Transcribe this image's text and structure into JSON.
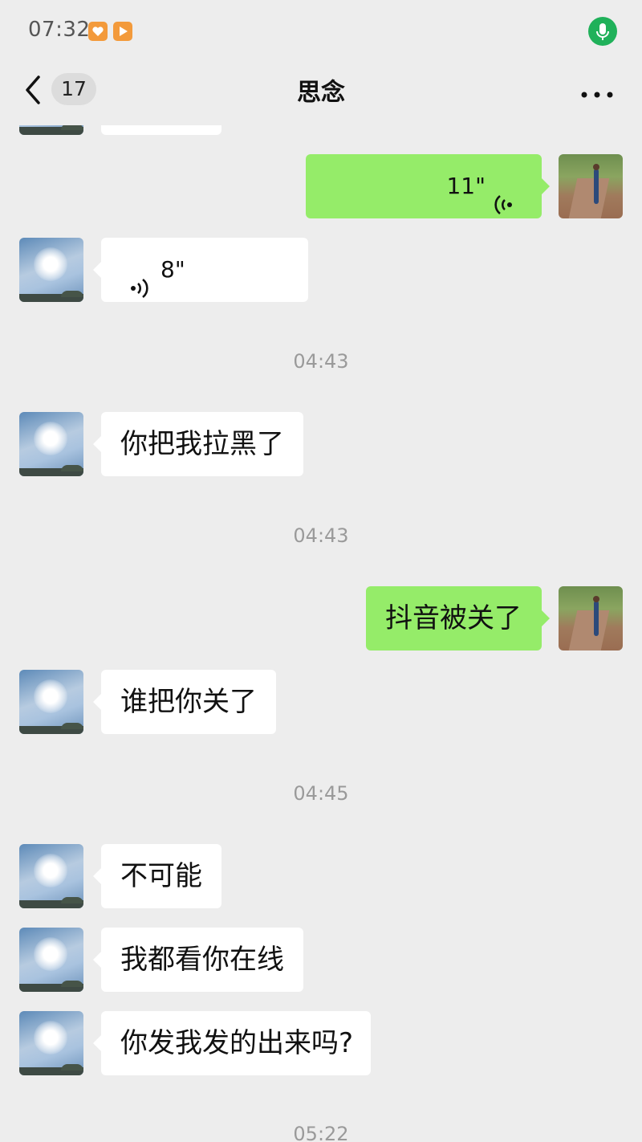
{
  "status_bar": {
    "time": "07:32"
  },
  "header": {
    "back_count": "17",
    "title": "思念"
  },
  "messages": [
    {
      "type": "voice",
      "side": "out",
      "duration": "11\""
    },
    {
      "type": "voice",
      "side": "in",
      "duration": "8\""
    },
    {
      "type": "time",
      "text": "04:43"
    },
    {
      "type": "text",
      "side": "in",
      "text": "你把我拉黑了"
    },
    {
      "type": "time",
      "text": "04:43"
    },
    {
      "type": "text",
      "side": "out",
      "text": "抖音被关了"
    },
    {
      "type": "text",
      "side": "in",
      "text": "谁把你关了"
    },
    {
      "type": "time",
      "text": "04:45"
    },
    {
      "type": "text",
      "side": "in",
      "text": "不可能"
    },
    {
      "type": "text",
      "side": "in",
      "text": "我都看你在线"
    },
    {
      "type": "text",
      "side": "in",
      "text": "你发我发的出来吗?"
    },
    {
      "type": "time",
      "text": "05:22"
    }
  ],
  "colors": {
    "outgoing_bubble": "#95ec69",
    "incoming_bubble": "#ffffff",
    "background": "#ededed"
  }
}
